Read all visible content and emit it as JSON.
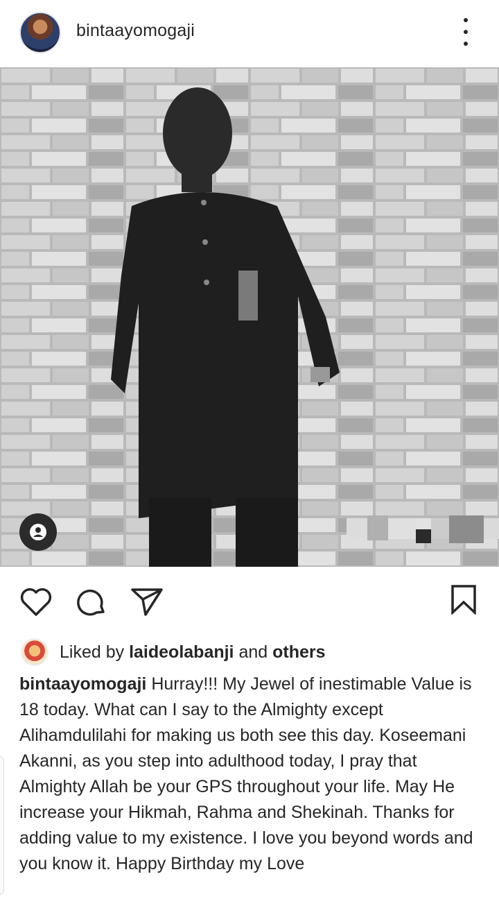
{
  "post": {
    "author": "bintaayomogaji",
    "more_icon": "more-vertical-icon"
  },
  "photo": {
    "tag_icon": "user-tag-icon"
  },
  "actions": {
    "like_icon": "heart-icon",
    "comment_icon": "comment-icon",
    "share_icon": "send-icon",
    "save_icon": "bookmark-icon"
  },
  "likes": {
    "prefix": "Liked by",
    "user": "laideolabanji",
    "middle": "and",
    "suffix": "others"
  },
  "caption": {
    "user": "bintaayomogaji",
    "text": "Hurray!!! My Jewel of inestimable Value is 18 today. What can I say to the Almighty except Alihamdulilahi for making us both see this day. Koseemani Akanni, as you step into adulthood today, I pray that Almighty Allah be your GPS throughout your life. May He increase your Hikmah, Rahma and Shekinah. Thanks for adding value to my existence. I love you beyond words and you know it. Happy Birthday my Love"
  }
}
